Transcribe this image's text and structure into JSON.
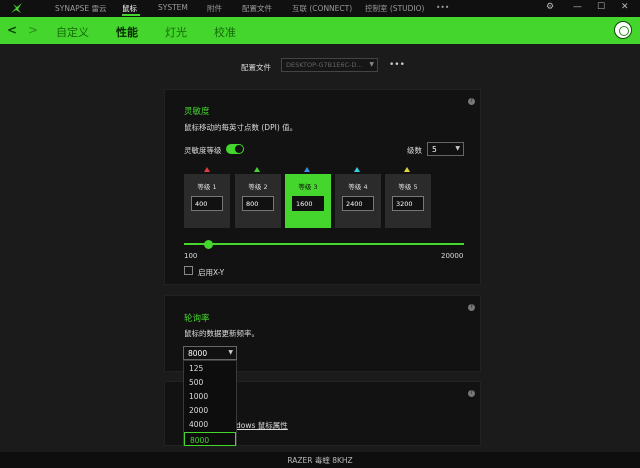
{
  "nav": {
    "items": [
      "SYNAPSE 雷云",
      "鼠标",
      "SYSTEM",
      "附件",
      "配置文件",
      "互联 (CONNECT)",
      "控制室 (STUDIO)",
      "•••"
    ],
    "active_index": 1
  },
  "window_controls": {
    "settings": "⚙",
    "minimize": "—",
    "maximize": "☐",
    "close": "✕"
  },
  "subtabs": {
    "back": "<",
    "forward": ">",
    "items": [
      "自定义",
      "性能",
      "灯光",
      "校准"
    ],
    "active_index": 1
  },
  "profile": {
    "label": "配置文件",
    "value": "DESKTOP-G7B1E6C-D...",
    "more": "•••"
  },
  "sensitivity": {
    "title": "灵敏度",
    "description": "鼠标移动的每英寸点数 (DPI) 值。",
    "stages_label": "灵敏度等级",
    "levels_label": "级数",
    "levels_value": "5",
    "stages": [
      {
        "label": "等级 1",
        "value": "400",
        "color": "#e03a3a"
      },
      {
        "label": "等级 2",
        "value": "800",
        "color": "#44d62c"
      },
      {
        "label": "等级 3",
        "value": "1600",
        "color": "#3a8ee0"
      },
      {
        "label": "等级 4",
        "value": "2400",
        "color": "#2fd0e0"
      },
      {
        "label": "等级 5",
        "value": "3200",
        "color": "#e0d53a"
      }
    ],
    "active_stage": 3,
    "slider_min": "100",
    "slider_max": "20000",
    "xy_label": "启用X-Y"
  },
  "polling": {
    "title": "轮询率",
    "description": "鼠标的数据更新频率。",
    "selected": "8000",
    "options": [
      "125",
      "500",
      "1000",
      "2000",
      "4000",
      "8000"
    ]
  },
  "card3": {
    "link_text": "dows 鼠标属性"
  },
  "status_bar": {
    "device": "RAZER 毒蝰 8KHZ"
  },
  "colors": {
    "accent": "#44d62c",
    "background": "#1b1b1b",
    "card": "#121212"
  }
}
